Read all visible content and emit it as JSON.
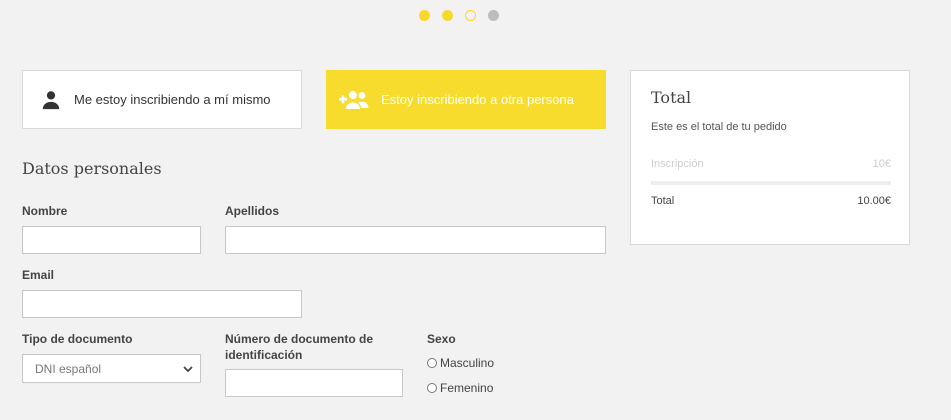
{
  "steps": [
    "filled",
    "filled",
    "outline",
    "grey"
  ],
  "choices": {
    "self_label": "Me estoy inscribiendo a mí mismo",
    "other_label": "Estoy inscribiendo a otra persona"
  },
  "form": {
    "section_title": "Datos personales",
    "nombre_label": "Nombre",
    "apellidos_label": "Apellidos",
    "email_label": "Email",
    "tipo_doc_label": "Tipo de documento",
    "tipo_doc_value": "DNI español",
    "numero_doc_label_line1": "Número de documento de",
    "numero_doc_label_line2": "identificación",
    "sexo_label": "Sexo",
    "sexo_options": [
      "Masculino",
      "Femenino"
    ]
  },
  "summary": {
    "title": "Total",
    "subtitle": "Este es el total de tu pedido",
    "item_label": "Inscripción",
    "item_value": "10€",
    "total_label": "Total",
    "total_value": "10.00€"
  },
  "colors": {
    "accent": "#f7dc2e"
  }
}
